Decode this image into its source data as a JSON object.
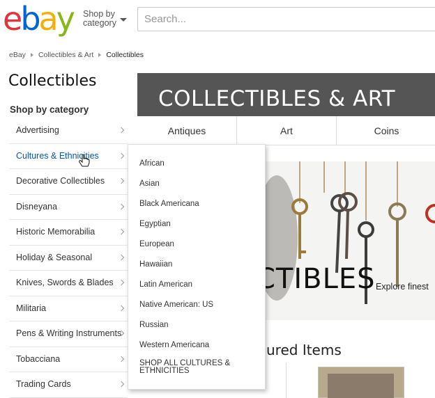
{
  "header": {
    "logo_letters": [
      "e",
      "b",
      "a",
      "y"
    ],
    "shop_by_line1": "Shop by",
    "shop_by_line2": "category",
    "search_placeholder": "Search..."
  },
  "breadcrumb": [
    "eBay",
    "Collectibles & Art",
    "Collectibles"
  ],
  "sidebar": {
    "title": "Collectibles",
    "heading": "Shop by category",
    "items": [
      {
        "label": "Advertising"
      },
      {
        "label": "Cultures & Ethnicities"
      },
      {
        "label": "Decorative Collectibles"
      },
      {
        "label": "Disneyana"
      },
      {
        "label": "Historic Memorabilia"
      },
      {
        "label": "Holiday & Seasonal"
      },
      {
        "label": "Knives, Swords & Blades"
      },
      {
        "label": "Militaria"
      },
      {
        "label": "Pens & Writing Instruments"
      },
      {
        "label": "Tobacciana"
      },
      {
        "label": "Trading Cards"
      }
    ],
    "active_index": 1
  },
  "hero": {
    "title": "COLLECTIBLES & ART"
  },
  "tabs": [
    "Antiques",
    "Art",
    "Coins"
  ],
  "banner": {
    "text": "CTIBLES",
    "subtext": "Explore finest"
  },
  "featured": {
    "title": "ured Items"
  },
  "flyout": {
    "items": [
      "African",
      "Asian",
      "Black Americana",
      "Egyptian",
      "European",
      "Hawaiian",
      "Latin American",
      "Native American: US",
      "Russian",
      "Western Americana"
    ],
    "shop_all": "SHOP ALL CULTURES & ETHNICITIES"
  },
  "colors": {
    "logo_e": "#e53238",
    "logo_b": "#0064d2",
    "logo_a": "#f5af02",
    "logo_y": "#86b817",
    "hero_band": "#555555",
    "active_link": "#0654ba"
  }
}
